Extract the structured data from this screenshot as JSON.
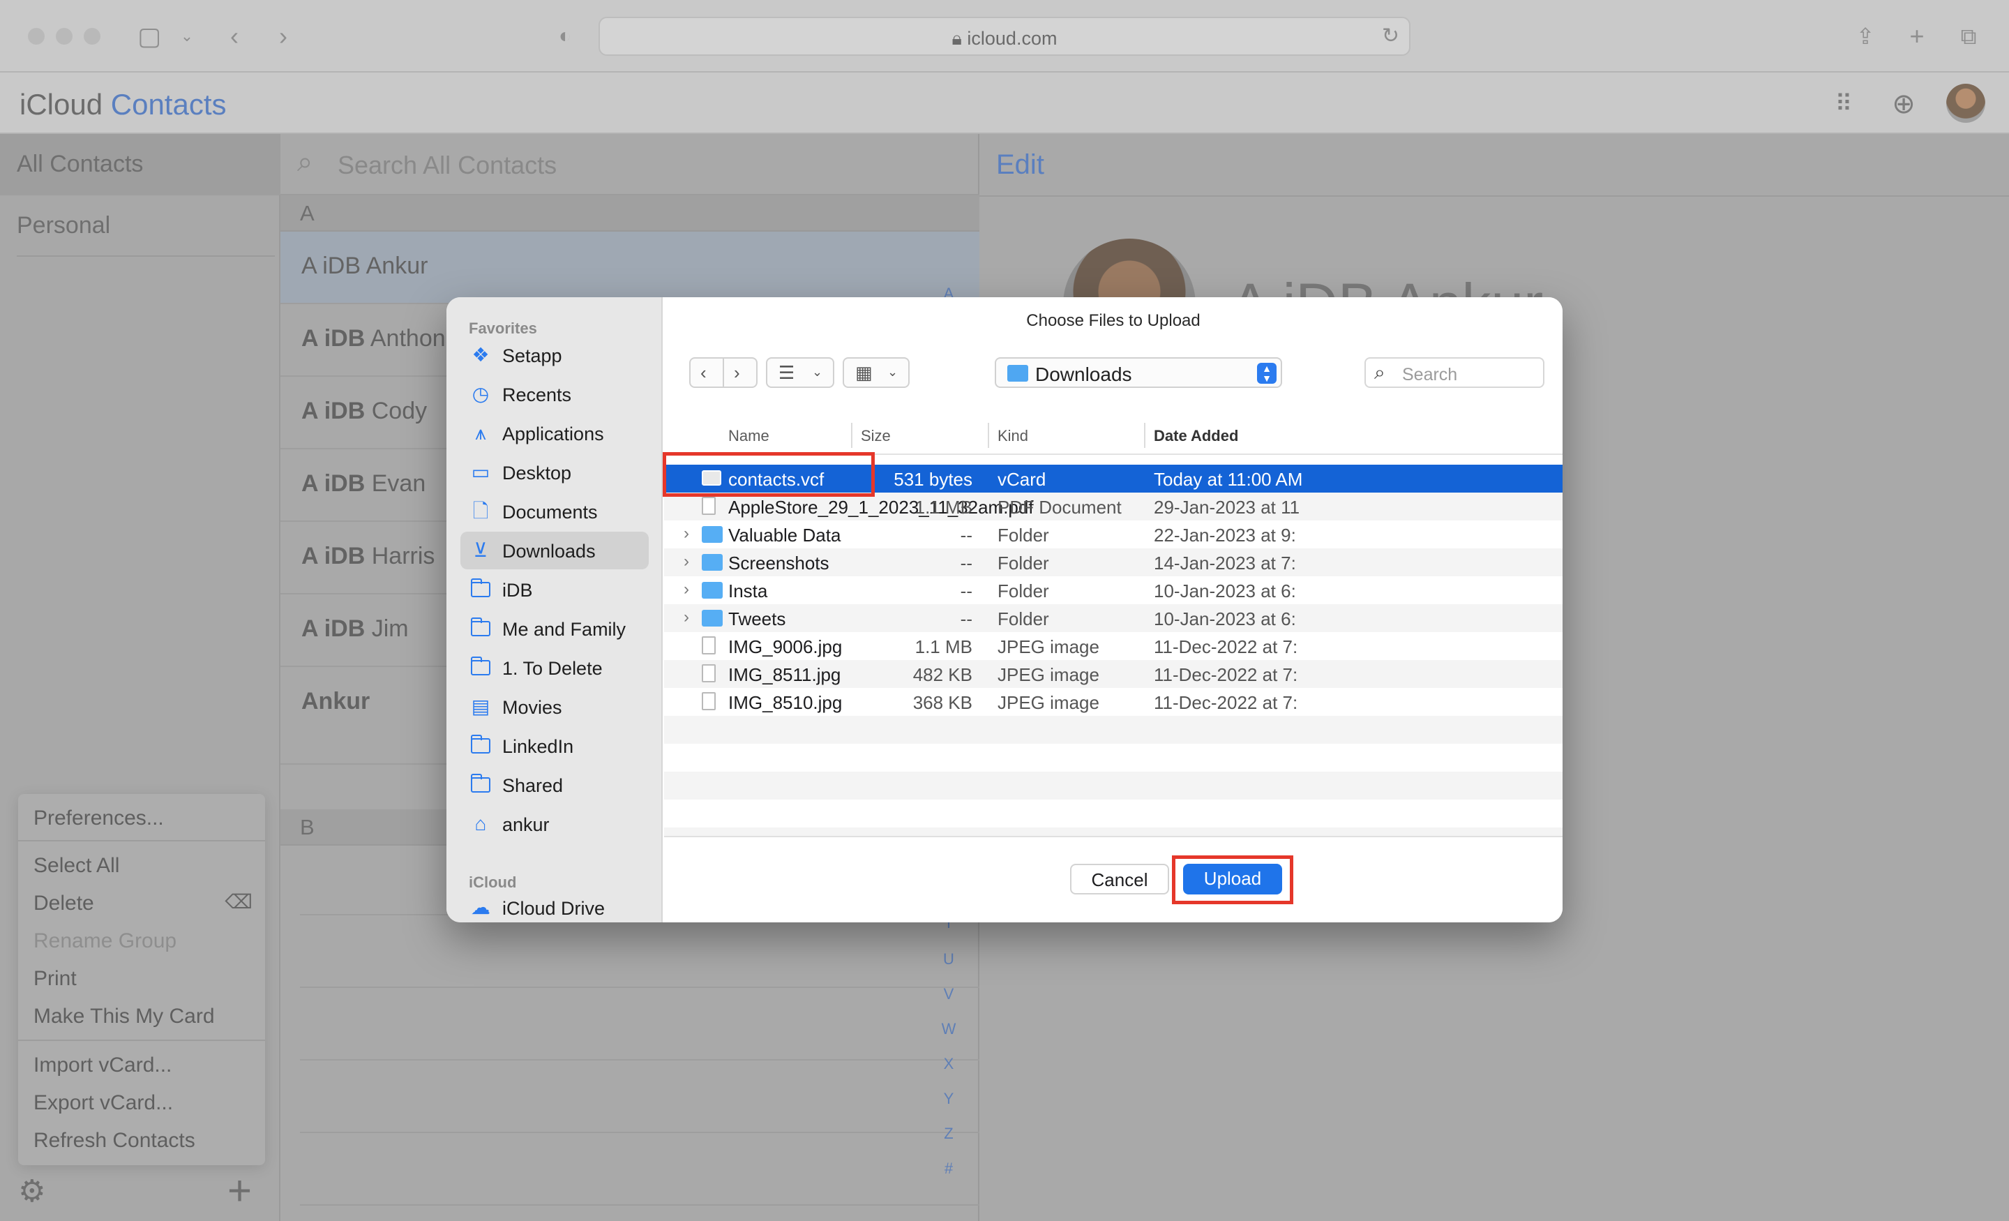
{
  "browser": {
    "url": "icloud.com",
    "lock_icon": "lock-icon",
    "reload_icon": "reload-icon"
  },
  "app": {
    "brand_main": "iCloud",
    "brand_sub": "Contacts"
  },
  "groups": [
    {
      "label": "All Contacts",
      "selected": true
    },
    {
      "label": "Personal",
      "selected": false
    }
  ],
  "list": {
    "search_placeholder": "Search All Contacts",
    "section_a": "A",
    "section_b": "B",
    "contacts": [
      {
        "prefix": "A iDB",
        "name": "Ankur",
        "selected": true
      },
      {
        "prefix": "A iDB",
        "name": "Anthon"
      },
      {
        "prefix": "A iDB",
        "name": "Cody"
      },
      {
        "prefix": "A iDB",
        "name": "Evan"
      },
      {
        "prefix": "A iDB",
        "name": "Harris"
      },
      {
        "prefix": "A iDB",
        "name": "Jim"
      },
      {
        "prefix": "",
        "name": "Ankur"
      }
    ],
    "index": [
      "A",
      "T",
      "U",
      "V",
      "W",
      "X",
      "Y",
      "Z",
      "#"
    ]
  },
  "detail": {
    "edit_label": "Edit",
    "name": "A iDB Ankur"
  },
  "gear_menu": {
    "preferences": "Preferences...",
    "select_all": "Select All",
    "delete": "Delete",
    "rename_group": "Rename Group",
    "print": "Print",
    "make_my_card": "Make This My Card",
    "import_vcard": "Import vCard...",
    "export_vcard": "Export vCard...",
    "refresh": "Refresh Contacts"
  },
  "dialog": {
    "title": "Choose Files to Upload",
    "location": "Downloads",
    "search_placeholder": "Search",
    "sidebar_heading_favorites": "Favorites",
    "sidebar_heading_icloud": "iCloud",
    "sidebar": [
      {
        "label": "Setapp",
        "icon": "setapp-icon"
      },
      {
        "label": "Recents",
        "icon": "clock-icon"
      },
      {
        "label": "Applications",
        "icon": "applications-icon"
      },
      {
        "label": "Desktop",
        "icon": "desktop-icon"
      },
      {
        "label": "Documents",
        "icon": "document-icon"
      },
      {
        "label": "Downloads",
        "icon": "download-icon",
        "selected": true
      },
      {
        "label": "iDB",
        "icon": "folder-icon"
      },
      {
        "label": "Me and Family",
        "icon": "folder-icon"
      },
      {
        "label": "1. To Delete",
        "icon": "folder-icon"
      },
      {
        "label": "Movies",
        "icon": "film-icon"
      },
      {
        "label": "LinkedIn",
        "icon": "folder-icon"
      },
      {
        "label": "Shared",
        "icon": "folder-icon"
      },
      {
        "label": "ankur",
        "icon": "home-icon"
      }
    ],
    "icloud_drive": "iCloud Drive",
    "columns": {
      "name": "Name",
      "size": "Size",
      "kind": "Kind",
      "date": "Date Added"
    },
    "files": [
      {
        "name": "contacts.vcf",
        "size": "531 bytes",
        "kind": "vCard",
        "date": "Today at 11:00 AM",
        "type": "vcard",
        "selected": true
      },
      {
        "name": "AppleStore_29_1_2023_11_32am.pdf",
        "size": "1.1 MB",
        "kind": "PDF Document",
        "date": "29-Jan-2023 at 11",
        "type": "doc"
      },
      {
        "name": "Valuable Data",
        "size": "--",
        "kind": "Folder",
        "date": "22-Jan-2023 at 9:",
        "type": "folder"
      },
      {
        "name": "Screenshots",
        "size": "--",
        "kind": "Folder",
        "date": "14-Jan-2023 at 7:",
        "type": "folder"
      },
      {
        "name": "Insta",
        "size": "--",
        "kind": "Folder",
        "date": "10-Jan-2023 at 6:",
        "type": "folder"
      },
      {
        "name": "Tweets",
        "size": "--",
        "kind": "Folder",
        "date": "10-Jan-2023 at 6:",
        "type": "folder"
      },
      {
        "name": "IMG_9006.jpg",
        "size": "1.1 MB",
        "kind": "JPEG image",
        "date": "11-Dec-2022 at 7:",
        "type": "doc"
      },
      {
        "name": "IMG_8511.jpg",
        "size": "482 KB",
        "kind": "JPEG image",
        "date": "11-Dec-2022 at 7:",
        "type": "doc"
      },
      {
        "name": "IMG_8510.jpg",
        "size": "368 KB",
        "kind": "JPEG image",
        "date": "11-Dec-2022 at 7:",
        "type": "doc"
      }
    ],
    "cancel_label": "Cancel",
    "upload_label": "Upload"
  },
  "colors": {
    "accent": "#1f74ea",
    "selection": "#1463d6",
    "highlight_box": "#e5372a"
  }
}
